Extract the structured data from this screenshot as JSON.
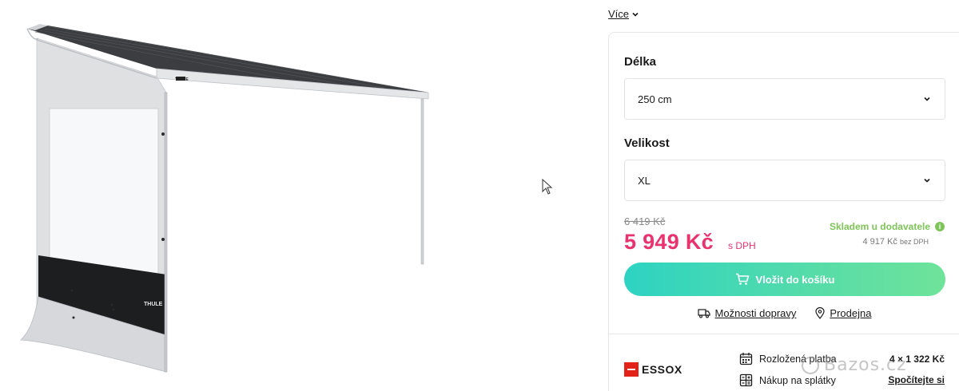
{
  "more_link": "Více",
  "options": {
    "length_label": "Délka",
    "length_value": "250 cm",
    "size_label": "Velikost",
    "size_value": "XL"
  },
  "pricing": {
    "old_price": "6 419 Kč",
    "price": "5 949 Kč",
    "price_suffix": "s DPH",
    "stock_status": "Skladem u dodavatele",
    "net_price": "4 917 Kč",
    "net_suffix": "bez DPH",
    "stock_color": "#7fc458",
    "price_color": "#e8336f"
  },
  "cart_button": "Vložit do košíku",
  "links": {
    "shipping": "Možnosti dopravy",
    "store": "Prodejna"
  },
  "financing": {
    "brand": "ESSOX",
    "installment_label": "Rozložená platba",
    "installment_value": "4 × 1 322 Kč",
    "loan_label": "Nákup na splátky",
    "loan_value": "Spočítejte si"
  },
  "product_image": {
    "brand_logo": "THULE"
  },
  "watermark": "Bazos.cz"
}
